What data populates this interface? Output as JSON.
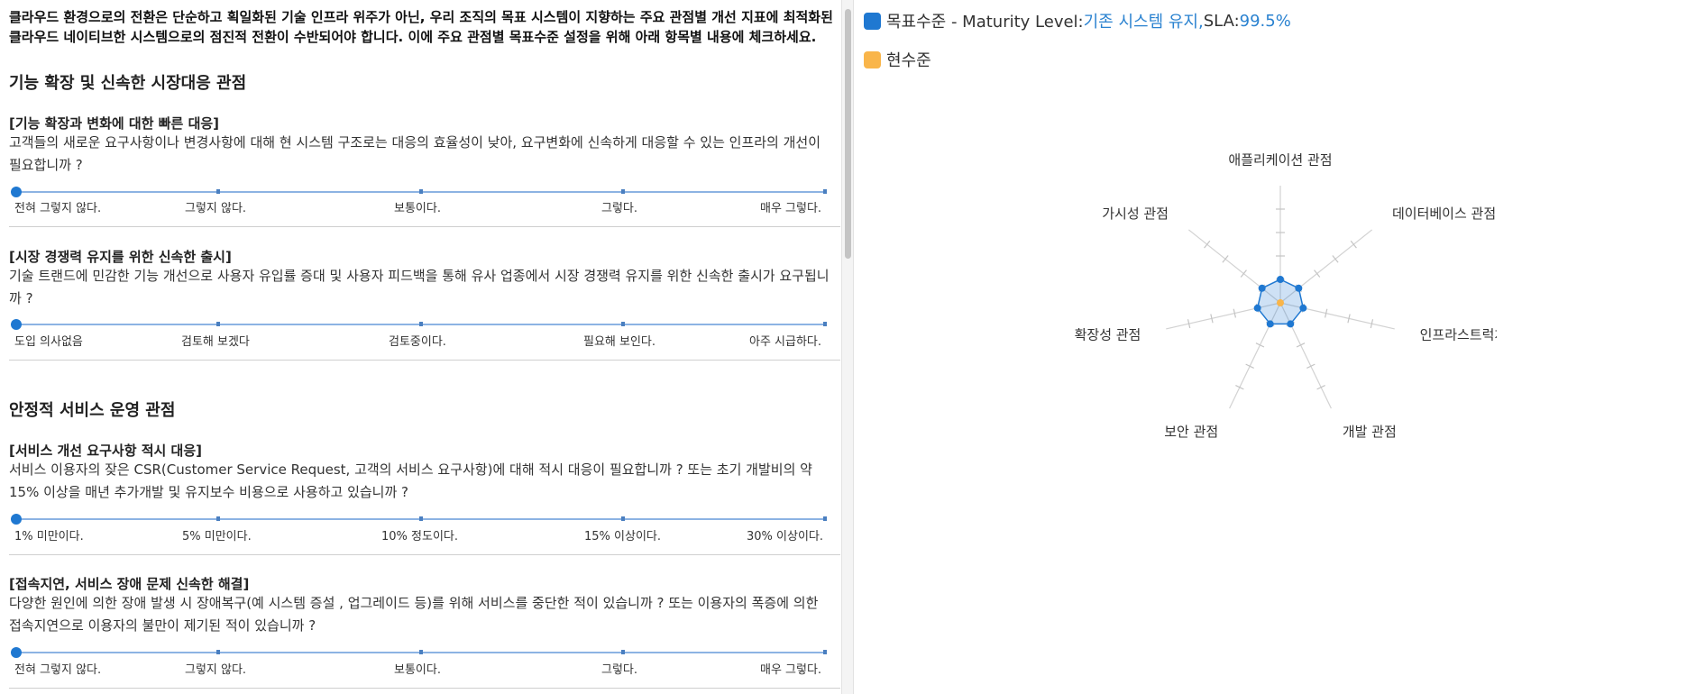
{
  "intro": "클라우드 환경으로의 전환은 단순하고 획일화된 기술 인프라 위주가 아닌, 우리 조직의 목표 시스템이 지향하는 주요 관점별 개선 지표에 최적화된 클라우드 네이티브한 시스템으로의 점진적 전환이 수반되어야 합니다. 이에 주요 관점별 목표수준 설정을 위해 아래 항목별 내용에 체크하세요.",
  "sections": [
    {
      "title": "기능 확장 및 신속한 시장대응 관점",
      "questions": [
        {
          "title": "[기능 확장과 변화에 대한 빠른 대응]",
          "body": "고객들의 새로운 요구사항이나 변경사항에 대해 현 시스템 구조로는 대응의 효율성이 낮아, 요구변화에 신속하게 대응할 수 있는 인프라의 개선이 필요합니까 ?",
          "options": [
            "전혀 그렇지 않다.",
            "그렇지 않다.",
            "보통이다.",
            "그렇다.",
            "매우 그렇다."
          ],
          "selected": 0
        },
        {
          "title": "[시장 경쟁력 유지를 위한 신속한 출시]",
          "body": "기술 트랜드에 민감한 기능 개선으로 사용자 유입률 증대 및 사용자 피드백을 통해 유사 업종에서 시장 경쟁력 유지를 위한 신속한 출시가 요구됩니까 ?",
          "options": [
            "도입 의사없음",
            "검토해 보겠다",
            "검토중이다.",
            "필요해 보인다.",
            "아주 시급하다."
          ],
          "selected": 0
        }
      ]
    },
    {
      "title": "안정적 서비스 운영 관점",
      "questions": [
        {
          "title": "[서비스 개선 요구사항 적시 대응]",
          "body": "서비스 이용자의 잦은 CSR(Customer Service Request, 고객의 서비스 요구사항)에 대해 적시 대응이 필요합니까 ? 또는 초기 개발비의 약 15% 이상을 매년 추가개발 및 유지보수 비용으로 사용하고 있습니까 ?",
          "options": [
            "1% 미만이다.",
            "5% 미만이다.",
            "10% 정도이다.",
            "15% 이상이다.",
            "30% 이상이다."
          ],
          "selected": 0
        },
        {
          "title": "[접속지연, 서비스 장애 문제 신속한 해결]",
          "body": "다양한 원인에 의한 장애 발생 시 장애복구(예 시스템 증설 , 업그레이드 등)를 위해 서비스를 중단한 적이 있습니까 ? 또는 이용자의 폭증에 의한 접속지연으로 이용자의 불만이 제기된 적이 있습니까 ?",
          "options": [
            "전혀 그렇지 않다.",
            "그렇지 않다.",
            "보통이다.",
            "그렇다.",
            "매우 그렇다."
          ],
          "selected": 0
        }
      ]
    }
  ],
  "legend": {
    "target_label": "목표수준 - Maturity Level: ",
    "target_level": "기존 시스템 유지,",
    "sla_label": " SLA: ",
    "sla_value": "99.5%",
    "current_label": "현수준",
    "target_color": "#1f78d1",
    "current_color": "#f9b54a"
  },
  "radar": {
    "axes": [
      "애플리케이션 관점",
      "데이터베이스 관점",
      "인프라스트럭처 관점",
      "개발 관점",
      "보안 관점",
      "확장성 관점",
      "가시성 관점"
    ],
    "max": 5,
    "target_values": [
      1,
      1,
      1,
      1,
      1,
      1,
      1
    ],
    "current_values": [
      0,
      0,
      0,
      0,
      0,
      0,
      0
    ]
  }
}
